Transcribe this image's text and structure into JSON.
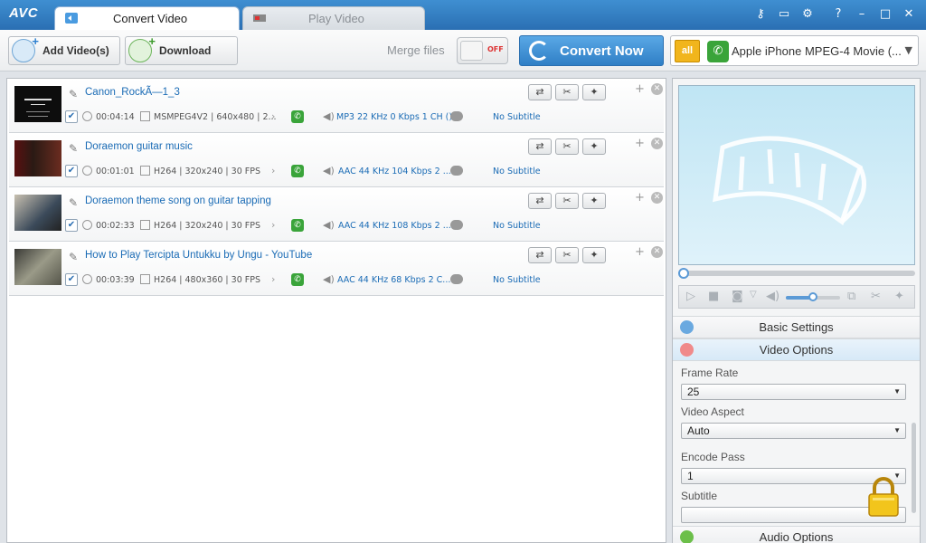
{
  "app": {
    "logo": "AVC"
  },
  "tabs": [
    {
      "label": "Convert Video",
      "active": true
    },
    {
      "label": "Play Video",
      "active": false
    }
  ],
  "window_controls": [
    "key-icon",
    "device-icon",
    "gear-icon",
    "help-icon",
    "minimize-icon",
    "maximize-icon",
    "close-icon"
  ],
  "toolbar": {
    "add_label": "Add Video(s)",
    "download_label": "Download",
    "merge_label": "Merge files",
    "merge_state": "OFF",
    "convert_label": "Convert Now",
    "profile_badge": "all",
    "profile_text": "Apple iPhone MPEG-4 Movie (..."
  },
  "videos": [
    {
      "title": "Canon_RockÃ—1_3",
      "duration": "00:04:14",
      "format": "MSMPEG4V2 | 640x480 | 2...",
      "audio": "MP3 22 KHz 0 Kbps 1 CH ()",
      "subtitle": "No Subtitle",
      "checked": true
    },
    {
      "title": "Doraemon guitar music",
      "duration": "00:01:01",
      "format": "H264 | 320x240 | 30 FPS",
      "audio": "AAC 44 KHz 104 Kbps 2 ...",
      "subtitle": "No Subtitle",
      "checked": true
    },
    {
      "title": "Doraemon theme song on guitar tapping",
      "duration": "00:02:33",
      "format": "H264 | 320x240 | 30 FPS",
      "audio": "AAC 44 KHz 108 Kbps 2 ...",
      "subtitle": "No Subtitle",
      "checked": true
    },
    {
      "title": "How to Play Tercipta Untukku by Ungu - YouTube",
      "duration": "00:03:39",
      "format": "H264 | 480x360 | 30 FPS",
      "audio": "AAC 44 KHz 68 Kbps 2 C...",
      "subtitle": "No Subtitle",
      "checked": true
    }
  ],
  "player": {
    "volume_fraction": 0.5,
    "seek_fraction": 0
  },
  "settings": {
    "basic_label": "Basic Settings",
    "video_label": "Video Options",
    "audio_label": "Audio Options",
    "frame_rate_label": "Frame Rate",
    "frame_rate_value": "25",
    "aspect_label": "Video Aspect",
    "aspect_value": "Auto",
    "encode_pass_label": "Encode Pass",
    "encode_pass_value": "1",
    "subtitle_label": "Subtitle",
    "subtitle_value": ""
  },
  "colors": {
    "accent": "#2f7fc6",
    "link": "#1a6bb5",
    "title_bar": "#2a6fb3"
  }
}
